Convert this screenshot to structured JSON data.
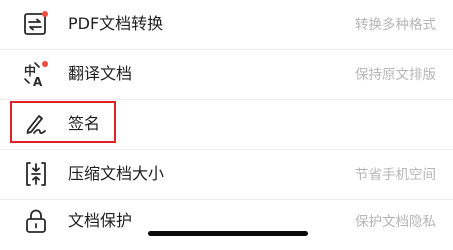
{
  "colors": {
    "accent_red": "#e0202a",
    "badge_red": "#ef4b3c",
    "icon_stroke": "#2a2a2a",
    "label": "#1f1f1f",
    "description": "#b5b5b5",
    "divider": "#ededed"
  },
  "items": [
    {
      "label": "PDF文档转换",
      "desc": "转换多种格式",
      "icon": "convert-icon",
      "badge": true
    },
    {
      "label": "翻译文档",
      "desc": "保持原文排版",
      "icon": "translate-icon",
      "badge": true
    },
    {
      "label": "签名",
      "desc": "",
      "icon": "signature-pen-icon",
      "badge": false,
      "highlighted": true
    },
    {
      "label": "压缩文档大小",
      "desc": "节省手机空间",
      "icon": "compress-icon",
      "badge": false
    },
    {
      "label": "文档保护",
      "desc": "保护文档隐私",
      "icon": "lock-icon",
      "badge": false
    }
  ]
}
